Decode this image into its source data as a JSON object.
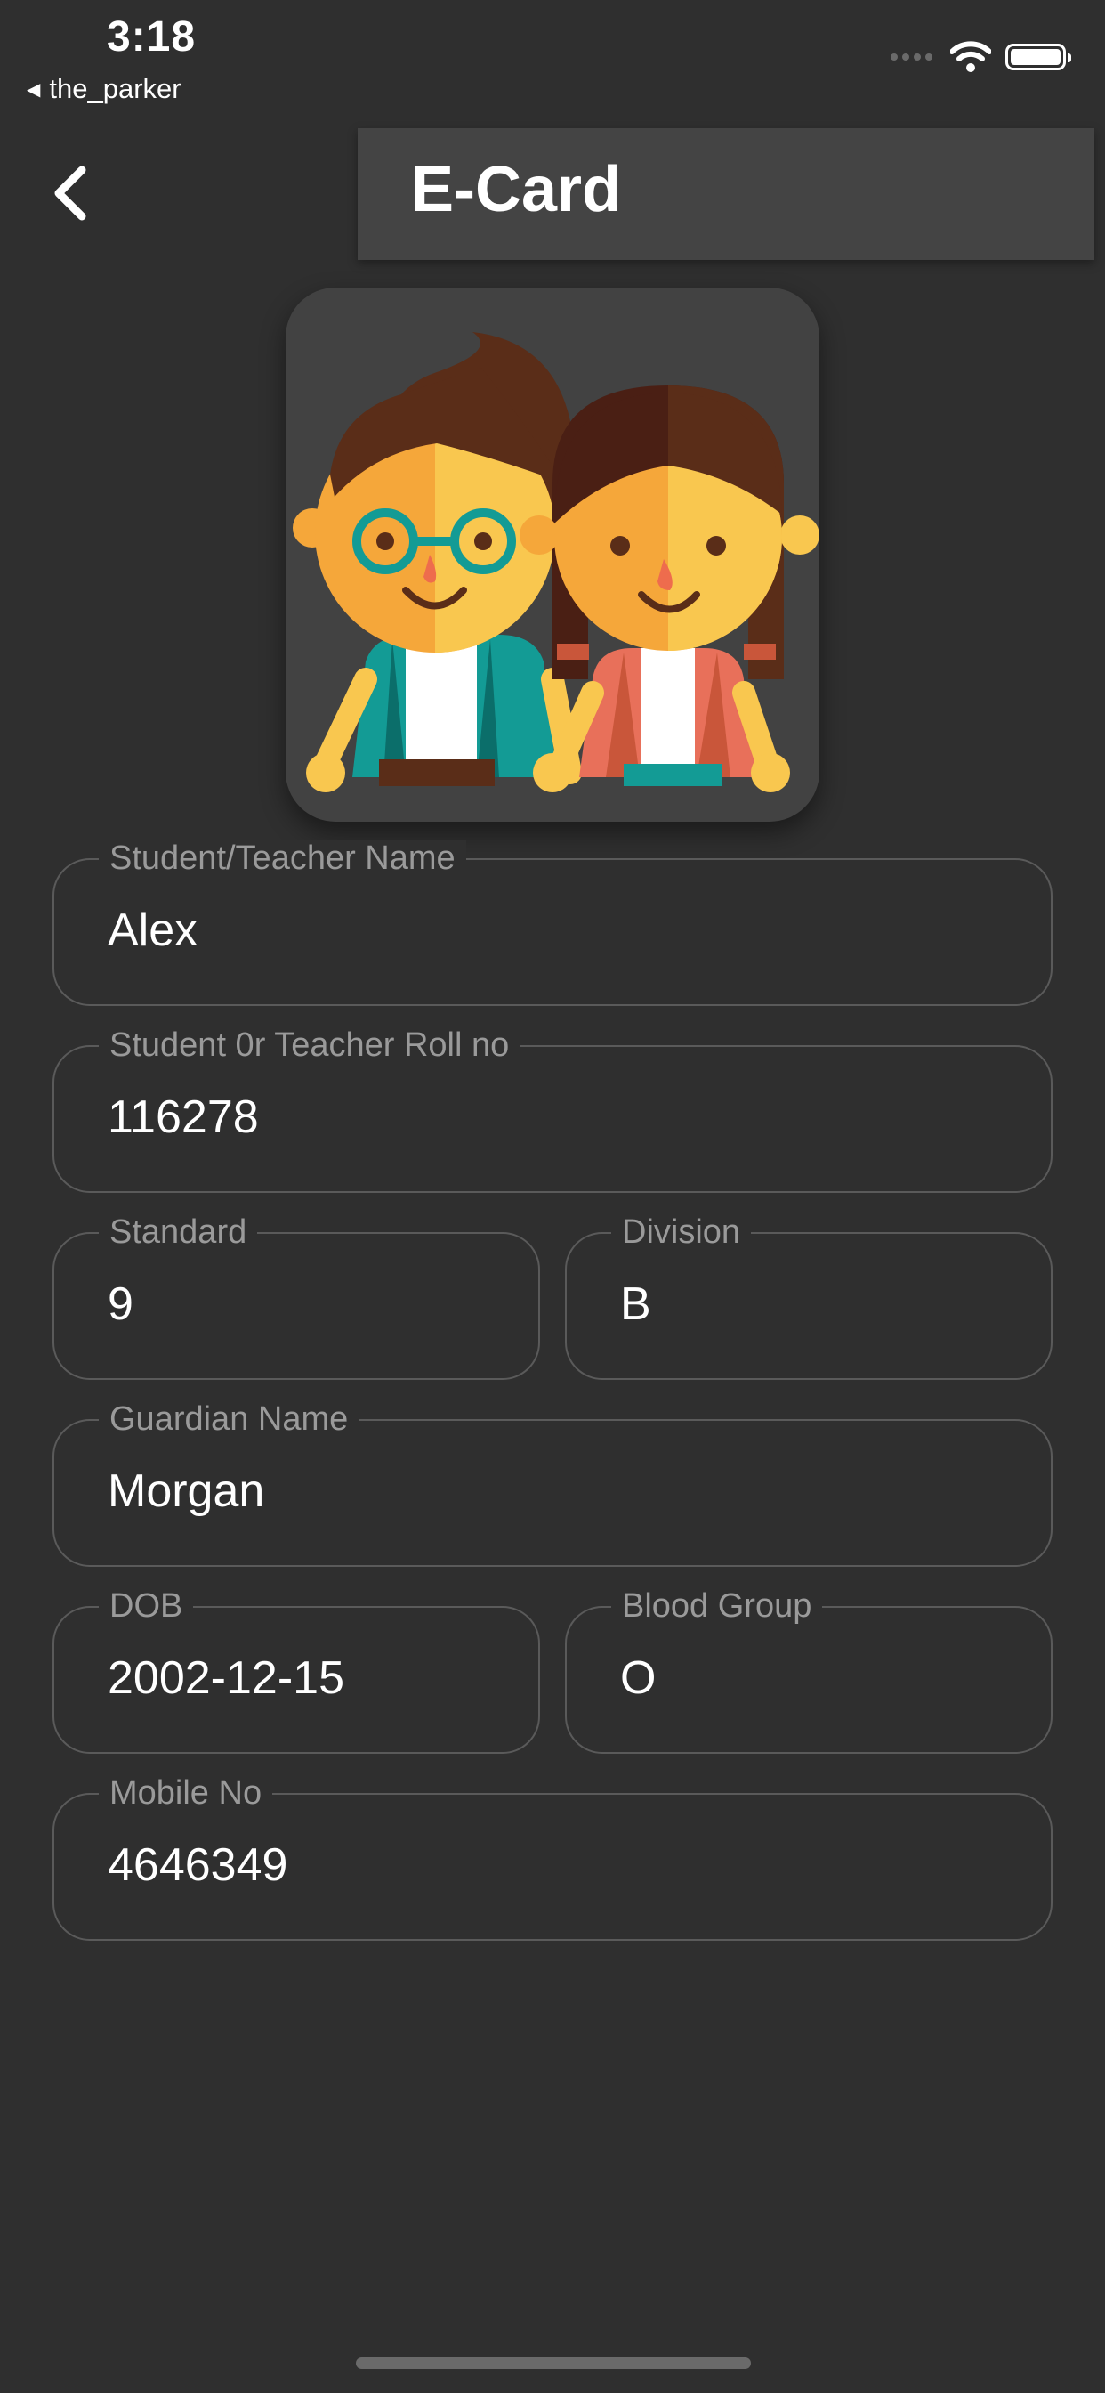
{
  "status_bar": {
    "time": "3:18",
    "back_app": "the_parker"
  },
  "header": {
    "title": "E-Card"
  },
  "fields": {
    "name": {
      "label": "Student/Teacher Name",
      "value": "Alex"
    },
    "roll": {
      "label": "Student 0r Teacher Roll no",
      "value": "116278"
    },
    "standard": {
      "label": "Standard",
      "value": "9"
    },
    "division": {
      "label": "Division",
      "value": "B"
    },
    "guardian": {
      "label": "Guardian Name",
      "value": "Morgan"
    },
    "dob": {
      "label": "DOB",
      "value": "2002-12-15"
    },
    "blood_group": {
      "label": "Blood Group",
      "value": "O"
    },
    "mobile": {
      "label": "Mobile No",
      "value": "4646349"
    }
  },
  "icons": {
    "back": "chevron-left-icon",
    "avatar": "students-illustration",
    "wifi": "wifi-icon",
    "battery": "battery-icon"
  },
  "colors": {
    "background": "#2f2f2f",
    "header": "#444444",
    "field_border": "#5a5a5a",
    "label": "#9a9a9a"
  }
}
